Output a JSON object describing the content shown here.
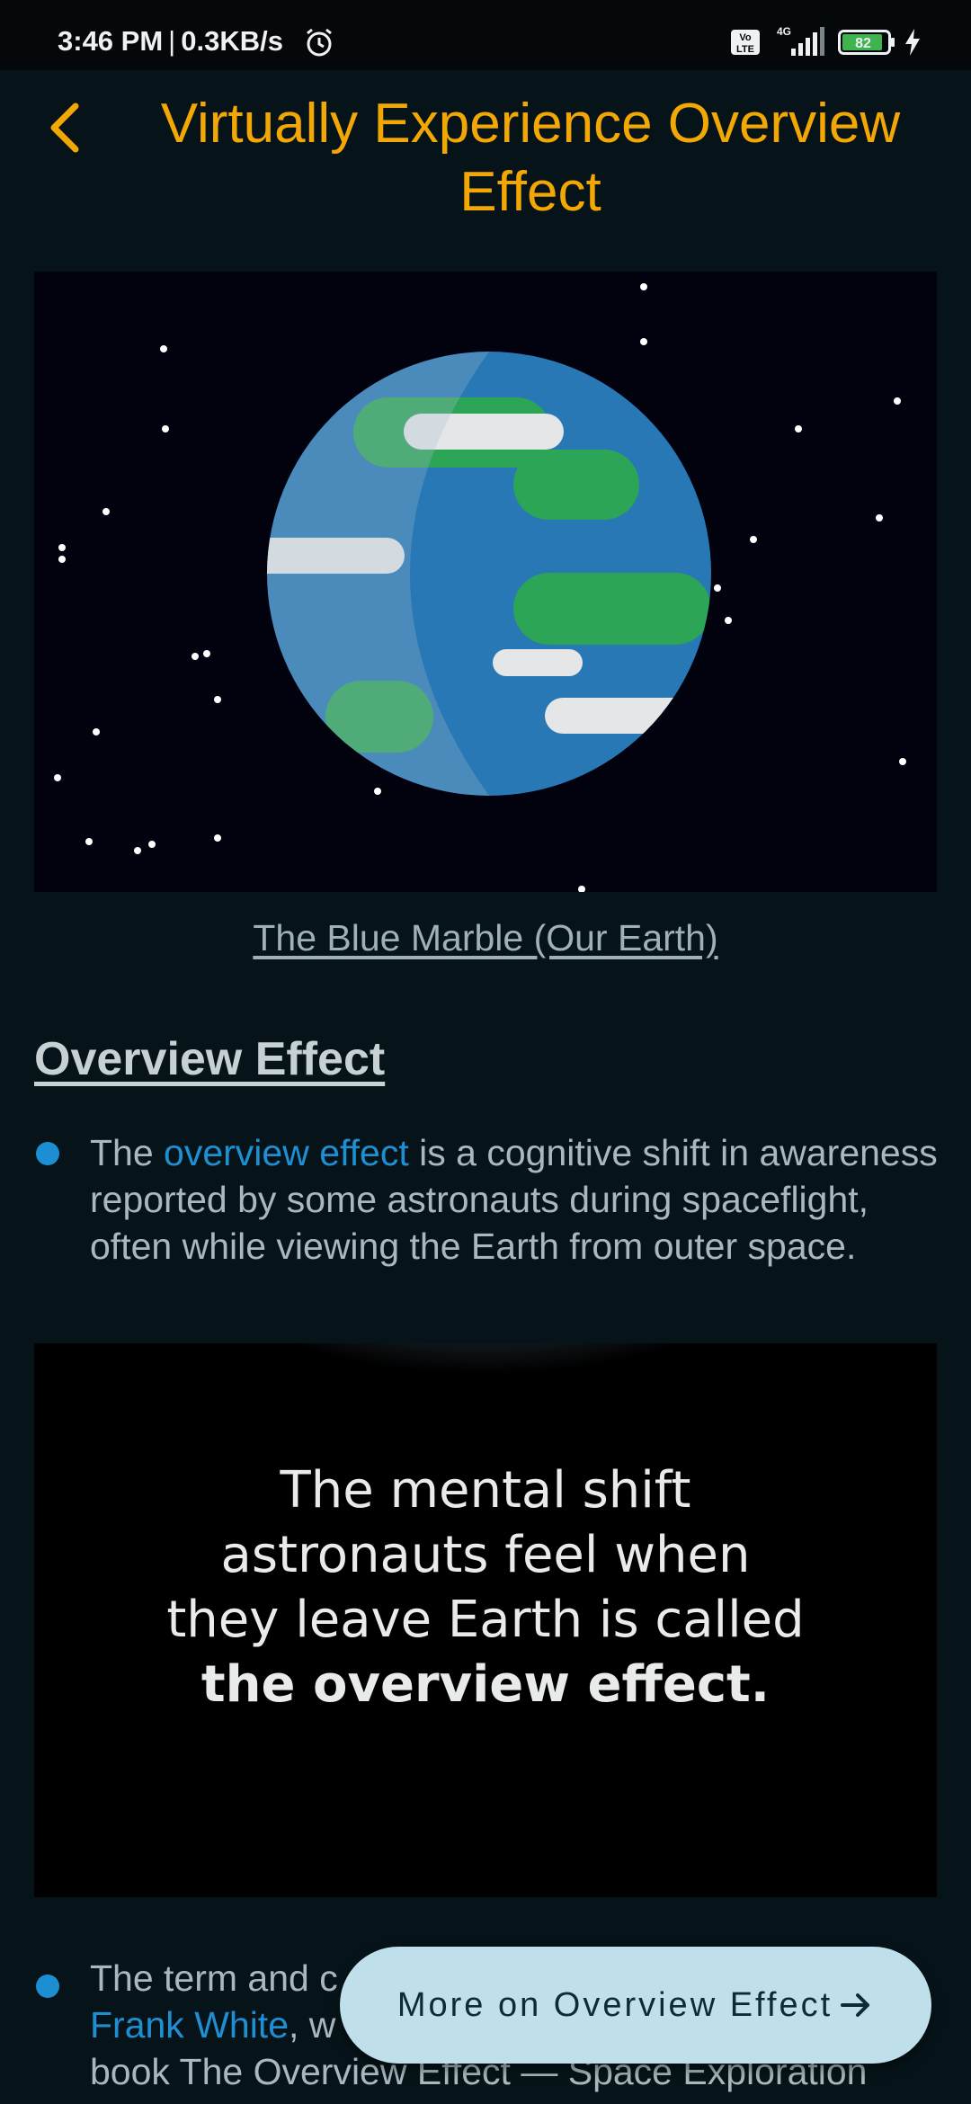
{
  "status_bar": {
    "time": "3:46 PM",
    "separator": "|",
    "speed": "0.3KB/s",
    "volte_label": "Vo LTE",
    "network_label": "4G",
    "battery_level": "82",
    "icons": [
      "alarm-icon",
      "volte-icon",
      "signal-icon",
      "battery-icon",
      "charging-icon"
    ]
  },
  "header": {
    "title": "Virtually Experience Overview Effect",
    "back_icon": "chevron-left-icon"
  },
  "hero": {
    "caption": "The Blue Marble (Our Earth)"
  },
  "section": {
    "heading": "Overview Effect"
  },
  "bullets": [
    {
      "before": "The ",
      "link": "overview effect",
      "after": " is a cognitive shift in awareness reported by some astronauts during spaceflight, often while viewing the Earth from outer space."
    },
    {
      "before": "The term and c",
      "link": "Frank White",
      "after": ", w",
      "line3": "book The Overview Effect — Space Exploration"
    }
  ],
  "quote_image": {
    "lines": [
      "The mental shift",
      "astronauts feel when",
      "they leave Earth is called",
      "the overview effect."
    ]
  },
  "fab": {
    "label": "More on Overview Effect",
    "icon": "arrow-right-icon"
  },
  "colors": {
    "background": "#061419",
    "title": "#f2a705",
    "link": "#1f8fd4",
    "fab": "#bfe0ea"
  }
}
